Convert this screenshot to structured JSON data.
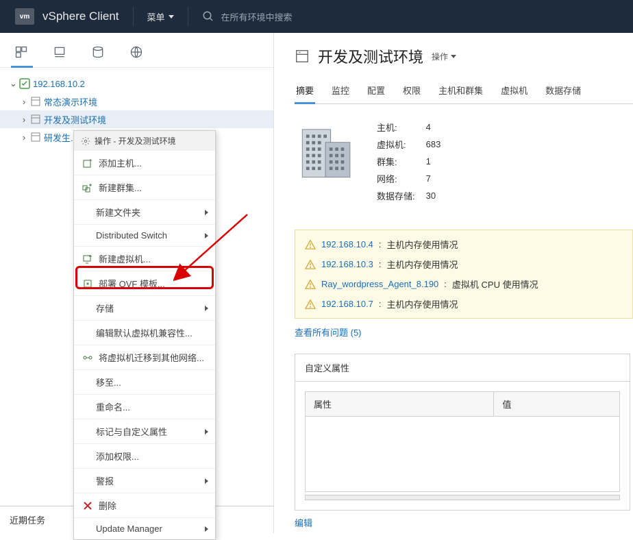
{
  "header": {
    "logo": "vm",
    "app_title": "vSphere Client",
    "menu_label": "菜单",
    "search_placeholder": "在所有环境中搜索"
  },
  "tree": {
    "root": "192.168.10.2",
    "children": [
      {
        "label": "常态演示环境",
        "icon": "datacenter"
      },
      {
        "label": "开发及测试环境",
        "icon": "datacenter",
        "selected": true
      },
      {
        "label": "研发生产环境",
        "icon": "datacenter",
        "truncated": "研发生..."
      }
    ]
  },
  "context_menu": {
    "header": "操作 - 开发及测试环境",
    "items": [
      {
        "label": "添加主机...",
        "icon": "add-host"
      },
      {
        "label": "新建群集...",
        "icon": "new-cluster"
      },
      {
        "label": "新建文件夹",
        "submenu": true,
        "indent": true
      },
      {
        "label": "Distributed Switch",
        "submenu": true,
        "indent": true
      },
      {
        "label": "新建虚拟机...",
        "icon": "new-vm"
      },
      {
        "label": "部署 OVF 模板...",
        "icon": "deploy-ovf",
        "highlighted": true
      },
      {
        "label": "存储",
        "submenu": true,
        "indent": true
      },
      {
        "label": "编辑默认虚拟机兼容性...",
        "indent": true
      },
      {
        "label": "将虚拟机迁移到其他网络...",
        "icon": "migrate"
      },
      {
        "label": "移至...",
        "indent": true
      },
      {
        "label": "重命名...",
        "indent": true
      },
      {
        "label": "标记与自定义属性",
        "submenu": true,
        "indent": true
      },
      {
        "label": "添加权限...",
        "indent": true
      },
      {
        "label": "警报",
        "submenu": true,
        "indent": true
      },
      {
        "label": "删除",
        "icon": "delete"
      },
      {
        "label": "Update Manager",
        "submenu": true,
        "indent": true
      }
    ]
  },
  "main": {
    "title": "开发及测试环境",
    "actions_label": "操作",
    "tabs": [
      "摘要",
      "监控",
      "配置",
      "权限",
      "主机和群集",
      "虚拟机",
      "数据存储"
    ],
    "active_tab": 0,
    "stats": {
      "主机": "4",
      "虚拟机": "683",
      "群集": "1",
      "网络": "7",
      "数据存储": "30"
    },
    "alerts": [
      {
        "link": "192.168.10.4",
        "text": "主机内存使用情况"
      },
      {
        "link": "192.168.10.3",
        "text": "主机内存使用情况"
      },
      {
        "link": "Ray_wordpress_Agent_8.190",
        "text": "虚拟机 CPU 使用情况"
      },
      {
        "link": "192.168.10.7",
        "text": "主机内存使用情况"
      }
    ],
    "view_all_issues": "查看所有问题 (5)",
    "custom_attrs": {
      "section_title": "自定义属性",
      "col_attr": "属性",
      "col_val": "值",
      "edit_label": "编辑"
    }
  },
  "bottom": {
    "recent_tasks": "近期任务"
  }
}
